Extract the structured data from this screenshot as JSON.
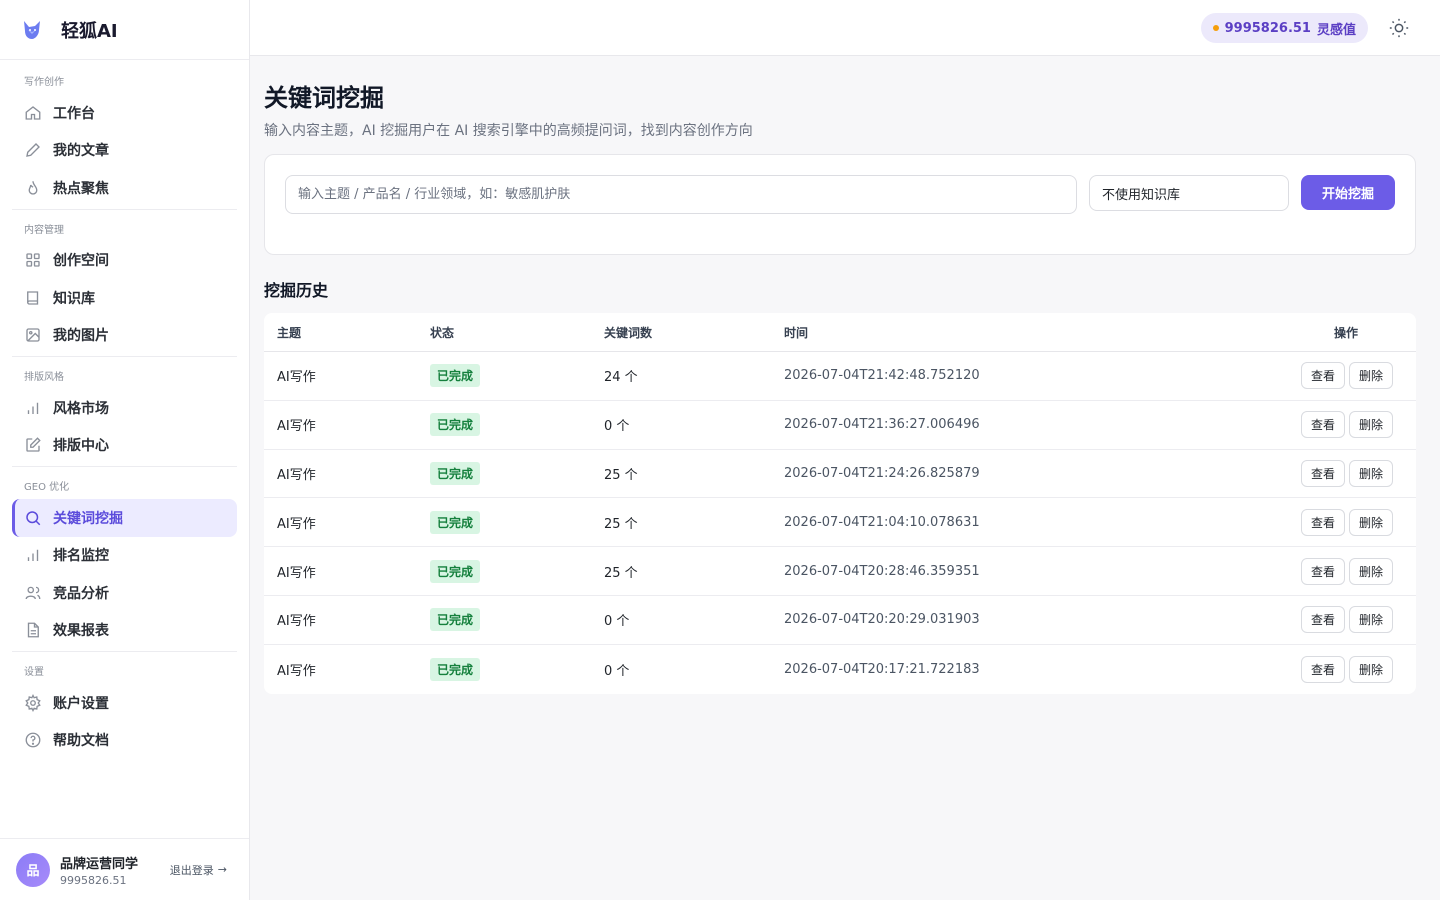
{
  "brand": {
    "name": "轻狐AI"
  },
  "sidebar": {
    "sections": [
      {
        "title": "写作创作",
        "items": [
          {
            "label": "工作台",
            "icon": "home-icon"
          },
          {
            "label": "我的文章",
            "icon": "pen-icon"
          },
          {
            "label": "热点聚焦",
            "icon": "flame-icon"
          }
        ]
      },
      {
        "title": "内容管理",
        "items": [
          {
            "label": "创作空间",
            "icon": "grid-icon"
          },
          {
            "label": "知识库",
            "icon": "book-icon"
          },
          {
            "label": "我的图片",
            "icon": "image-icon"
          }
        ]
      },
      {
        "title": "排版风格",
        "items": [
          {
            "label": "风格市场",
            "icon": "bar-chart-icon"
          },
          {
            "label": "排版中心",
            "icon": "edit-icon"
          }
        ]
      },
      {
        "title": "GEO 优化",
        "items": [
          {
            "label": "关键词挖掘",
            "icon": "search-icon",
            "active": true
          },
          {
            "label": "排名监控",
            "icon": "bar-chart-icon"
          },
          {
            "label": "竞品分析",
            "icon": "users-icon"
          },
          {
            "label": "效果报表",
            "icon": "file-icon"
          }
        ]
      },
      {
        "title": "设置",
        "items": [
          {
            "label": "账户设置",
            "icon": "gear-icon"
          },
          {
            "label": "帮助文档",
            "icon": "help-icon"
          }
        ]
      }
    ]
  },
  "user": {
    "avatar_text": "品",
    "name": "品牌运营同学",
    "points": "9995826.51",
    "logout_label": "退出登录"
  },
  "topbar": {
    "credit_value": "9995826.51",
    "credit_label": "灵感值"
  },
  "page": {
    "title": "关键词挖掘",
    "description": "输入内容主题，AI 挖掘用户在 AI 搜索引擎中的高频提问词，找到内容创作方向"
  },
  "search": {
    "placeholder": "输入主题 / 产品名 / 行业领域，如：敏感肌护肤",
    "value": "",
    "kb_selected": "不使用知识库",
    "submit_label": "开始挖掘"
  },
  "history": {
    "title": "挖掘历史",
    "columns": [
      "主题",
      "状态",
      "关键词数",
      "时间",
      "操作"
    ],
    "view_label": "查看",
    "delete_label": "删除",
    "rows": [
      {
        "topic": "AI写作",
        "status": "已完成",
        "count": "24 个",
        "time": "2026-07-04T21:42:48.752120"
      },
      {
        "topic": "AI写作",
        "status": "已完成",
        "count": "0 个",
        "time": "2026-07-04T21:36:27.006496"
      },
      {
        "topic": "AI写作",
        "status": "已完成",
        "count": "25 个",
        "time": "2026-07-04T21:24:26.825879"
      },
      {
        "topic": "AI写作",
        "status": "已完成",
        "count": "25 个",
        "time": "2026-07-04T21:04:10.078631"
      },
      {
        "topic": "AI写作",
        "status": "已完成",
        "count": "25 个",
        "time": "2026-07-04T20:28:46.359351"
      },
      {
        "topic": "AI写作",
        "status": "已完成",
        "count": "0 个",
        "time": "2026-07-04T20:20:29.031903"
      },
      {
        "topic": "AI写作",
        "status": "已完成",
        "count": "0 个",
        "time": "2026-07-04T20:17:21.722183"
      }
    ]
  },
  "colors": {
    "accent": "#6c5ce7",
    "success_bg": "#d8f5e3",
    "success_text": "#15803d",
    "credit_dot": "#f59e0b"
  }
}
